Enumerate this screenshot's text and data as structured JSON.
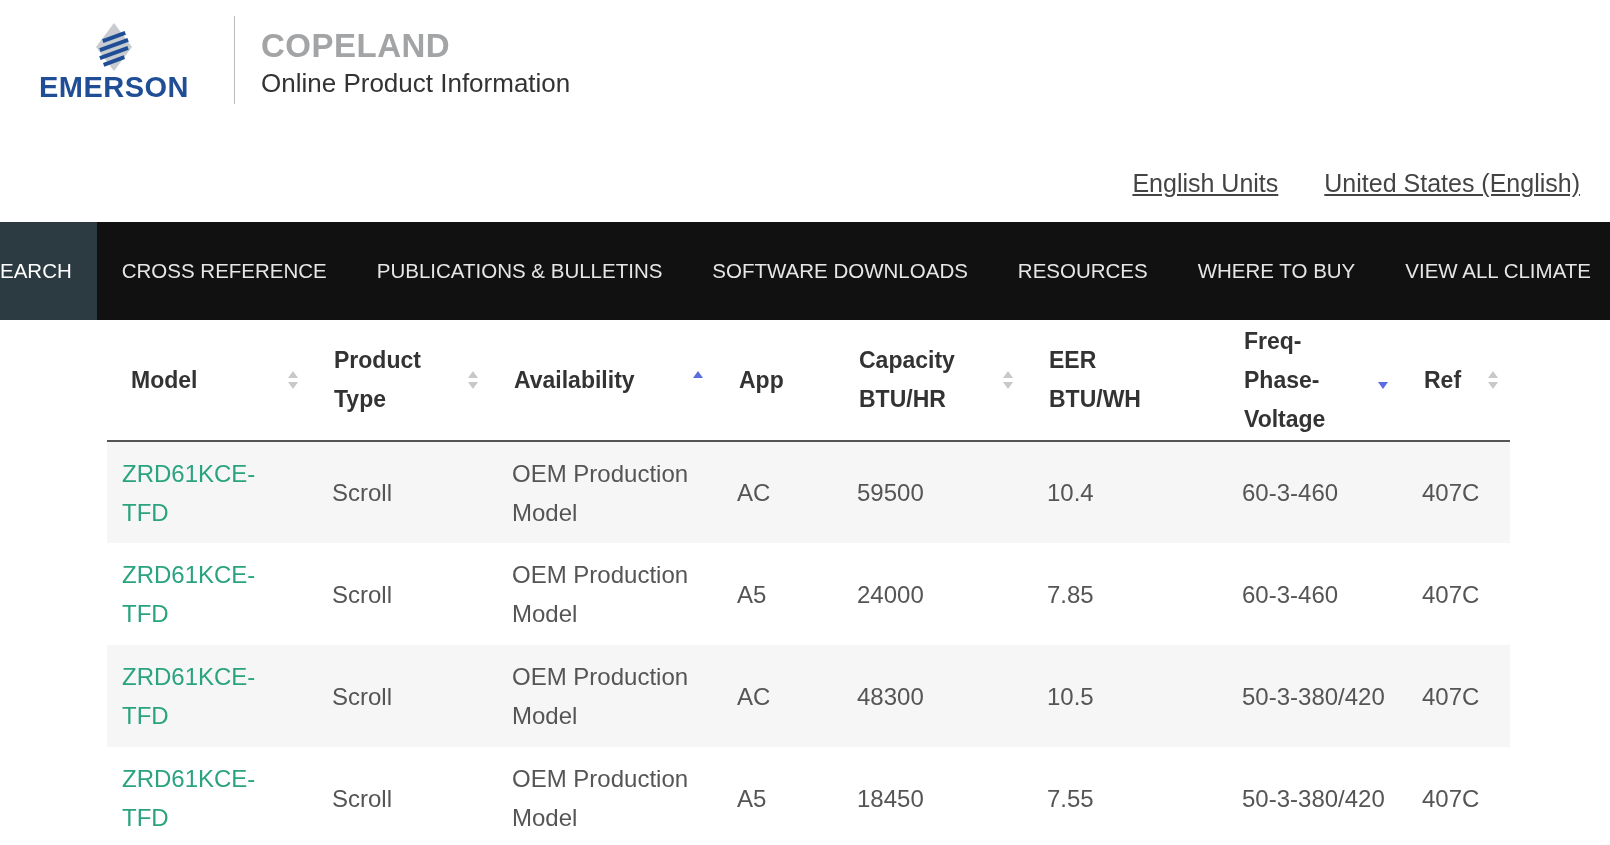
{
  "header": {
    "brand": "EMERSON",
    "product_brand": "COPELAND",
    "subtitle": "Online Product Information",
    "links": [
      "English Units",
      "United States (English)"
    ]
  },
  "nav": [
    {
      "label": "EARCH",
      "selected": true
    },
    {
      "label": "CROSS REFERENCE",
      "selected": false
    },
    {
      "label": "PUBLICATIONS & BULLETINS",
      "selected": false
    },
    {
      "label": "SOFTWARE DOWNLOADS",
      "selected": false
    },
    {
      "label": "RESOURCES",
      "selected": false
    },
    {
      "label": "WHERE TO BUY",
      "selected": false
    },
    {
      "label": "VIEW ALL CLIMATE",
      "selected": false
    }
  ],
  "table": {
    "columns": [
      {
        "label": "Model",
        "sortable": true,
        "sorted_ascending": false,
        "sorted_descending": false
      },
      {
        "label": "Product Type",
        "sortable": true,
        "sorted_ascending": false,
        "sorted_descending": false
      },
      {
        "label": "Availability",
        "sortable": true,
        "sorted_ascending": true,
        "sorted_descending": false
      },
      {
        "label": "App",
        "sortable": false,
        "sorted_ascending": false,
        "sorted_descending": false
      },
      {
        "label": "Capacity BTU/HR",
        "sortable": true,
        "sorted_ascending": false,
        "sorted_descending": false
      },
      {
        "label": "EER BTU/WH",
        "sortable": false,
        "sorted_ascending": false,
        "sorted_descending": false
      },
      {
        "label": "Freq-Phase-Voltage",
        "sortable": true,
        "sorted_ascending": false,
        "sorted_descending": true
      },
      {
        "label": "Ref",
        "sortable": true,
        "sorted_ascending": false,
        "sorted_descending": false
      }
    ],
    "rows": [
      [
        "ZRD61KCE-TFD",
        "Scroll",
        "OEM Production Model",
        "AC",
        "59500",
        "10.4",
        "60-3-460",
        "407C"
      ],
      [
        "ZRD61KCE-TFD",
        "Scroll",
        "OEM Production Model",
        "A5",
        "24000",
        "7.85",
        "60-3-460",
        "407C"
      ],
      [
        "ZRD61KCE-TFD",
        "Scroll",
        "OEM Production Model",
        "AC",
        "48300",
        "10.5",
        "50-3-380/420",
        "407C"
      ],
      [
        "ZRD61KCE-TFD",
        "Scroll",
        "OEM Production Model",
        "A5",
        "18450",
        "7.55",
        "50-3-380/420",
        "407C"
      ]
    ]
  }
}
